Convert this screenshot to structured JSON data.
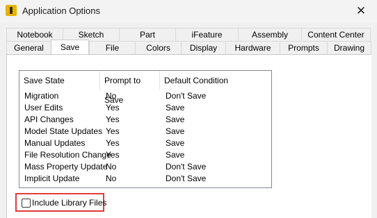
{
  "window": {
    "title": "Application Options",
    "close_glyph": "✕"
  },
  "tabs": {
    "back_row": [
      "Notebook",
      "Sketch",
      "Part",
      "iFeature",
      "Assembly",
      "Content Center"
    ],
    "front_row": [
      "General",
      "Save",
      "File",
      "Colors",
      "Display",
      "Hardware",
      "Prompts",
      "Drawing"
    ],
    "active": "Save"
  },
  "save_table": {
    "columns": [
      "Save State",
      "Prompt to Save",
      "Default Condition"
    ],
    "rows": [
      [
        "Migration",
        "No",
        "Don't Save"
      ],
      [
        "User Edits",
        "Yes",
        "Save"
      ],
      [
        "API Changes",
        "Yes",
        "Save"
      ],
      [
        "Model State Updates",
        "Yes",
        "Save"
      ],
      [
        "Manual Updates",
        "Yes",
        "Save"
      ],
      [
        "File Resolution Change",
        "Yes",
        "Save"
      ],
      [
        "Mass Property Update",
        "No",
        "Don't Save"
      ],
      [
        "Implicit Update",
        "No",
        "Don't Save"
      ]
    ]
  },
  "include_library": {
    "label": "Include Library Files",
    "checked": false
  },
  "colors": {
    "highlight_border": "#e23a3a",
    "app_icon": "#e8b400"
  }
}
